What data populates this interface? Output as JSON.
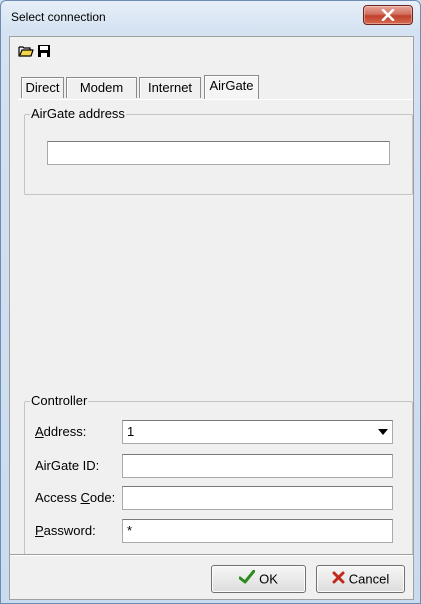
{
  "window": {
    "title": "Select connection",
    "close_glyph": "X"
  },
  "toolbar": {
    "open_icon": "folder-open-icon",
    "save_icon": "floppy-disk-icon"
  },
  "tabs": [
    {
      "label": "Direct",
      "active": false
    },
    {
      "label": "Modem",
      "active": false
    },
    {
      "label": "Internet",
      "active": false
    },
    {
      "label": "AirGate",
      "active": true
    }
  ],
  "airgate_group": {
    "title": "AirGate address",
    "address_value": ""
  },
  "controller": {
    "title": "Controller",
    "address": {
      "label_pre": "",
      "label_key": "A",
      "label_post": "ddress:",
      "value": "1"
    },
    "airgate_id": {
      "label": "AirGate ID:",
      "value": ""
    },
    "access_code": {
      "label_pre": "Access ",
      "label_key": "C",
      "label_post": "ode:",
      "value": ""
    },
    "password": {
      "label_pre": "",
      "label_key": "P",
      "label_post": "assword:",
      "value": "*"
    }
  },
  "buttons": {
    "ok": {
      "label": "OK",
      "icon": "checkmark-icon",
      "color": "#2e8b1f"
    },
    "cancel": {
      "label": "Cancel",
      "icon": "cross-icon",
      "color": "#c0281a"
    }
  }
}
